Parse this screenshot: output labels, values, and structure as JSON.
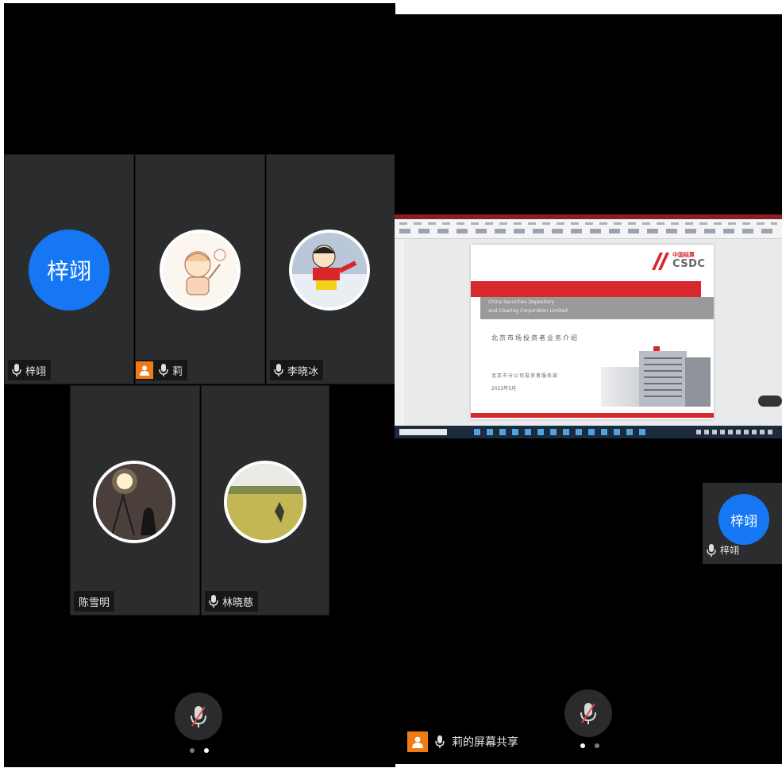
{
  "left_panel": {
    "tiles": [
      {
        "name": "梓翊",
        "avatar_type": "text",
        "avatar_text": "梓翊",
        "label": "梓翊",
        "muted": false,
        "host": false
      },
      {
        "name": "莉",
        "avatar_type": "image",
        "label": "莉",
        "muted": false,
        "host": true
      },
      {
        "name": "李晓冰",
        "avatar_type": "image",
        "label": "李晓冰",
        "muted": false,
        "host": false
      },
      {
        "name": "陈雪明",
        "avatar_type": "image",
        "label": "陈雪明",
        "muted": false,
        "host": false,
        "no_mic": true
      },
      {
        "name": "林晓慈",
        "avatar_type": "image",
        "label": "林晓慈",
        "muted": false,
        "host": false
      }
    ],
    "page_dots": {
      "count": 2,
      "active": 1
    }
  },
  "right_panel": {
    "share_label": "莉的屏幕共享",
    "slide": {
      "brand_cn": "中国结算",
      "brand_en": "CSDC",
      "subtitle_en_line1": "China Securities Depository",
      "subtitle_en_line2": "and Clearing Corporation Limited",
      "title_cn": "北京市场投资者业务介绍",
      "org_cn": "北京市分公司投资者服务部",
      "date": "2022年5月"
    },
    "pip": {
      "avatar_text": "梓翊",
      "label": "梓翊"
    },
    "page_dots": {
      "count": 2,
      "active": 0
    }
  },
  "colors": {
    "accent_blue": "#1677f5",
    "host_orange": "#f07a18",
    "tile_bg": "#2b2c2e",
    "csdc_red": "#d7282f"
  }
}
